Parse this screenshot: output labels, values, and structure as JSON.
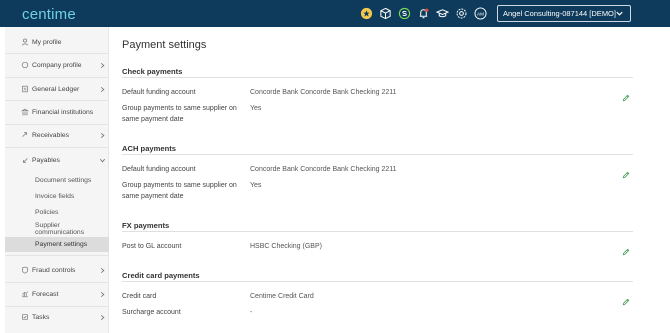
{
  "app": {
    "logo": "centime"
  },
  "header": {
    "icons": [
      "star-badge-icon",
      "cube-icon",
      "refresh-dollar-icon",
      "bell-icon",
      "graduation-cap-icon",
      "gear-icon",
      "user-initials-icon"
    ],
    "user_initials": "AM",
    "company": "Angel Consulting-087144 [DEMO]"
  },
  "sidebar": {
    "items": [
      {
        "label": "My profile",
        "icon": "user-icon"
      },
      {
        "label": "Company profile",
        "icon": "building-icon"
      },
      {
        "label": "General Ledger",
        "icon": "ledger-icon"
      },
      {
        "label": "Financial institutions",
        "icon": "bank-icon"
      },
      {
        "label": "Receivables",
        "icon": "receivables-icon"
      },
      {
        "label": "Payables",
        "icon": "payables-icon"
      },
      {
        "label": "Fraud controls",
        "icon": "shield-icon"
      },
      {
        "label": "Forecast",
        "icon": "chart-icon"
      },
      {
        "label": "Tasks",
        "icon": "tasks-icon"
      }
    ],
    "payables_sub": [
      {
        "label": "Document settings"
      },
      {
        "label": "Invoice fields"
      },
      {
        "label": "Policies"
      },
      {
        "label": "Supplier communications"
      },
      {
        "label": "Payment settings",
        "active": true
      }
    ]
  },
  "main": {
    "title": "Payment settings",
    "sections": [
      {
        "title": "Check payments",
        "fields": [
          {
            "label": "Default funding account",
            "value": "Concorde Bank Concorde Bank Checking 2211",
            "editable": true
          },
          {
            "label": "Group payments to same supplier on same payment date",
            "value": "Yes"
          }
        ]
      },
      {
        "title": "ACH payments",
        "fields": [
          {
            "label": "Default funding account",
            "value": "Concorde Bank Concorde Bank Checking 2211",
            "editable": true
          },
          {
            "label": "Group payments to same supplier on same payment date",
            "value": "Yes"
          }
        ]
      },
      {
        "title": "FX payments",
        "fields": [
          {
            "label": "Post to GL account",
            "value": "HSBC Checking (GBP)",
            "editable": true
          }
        ]
      },
      {
        "title": "Credit card payments",
        "fields": [
          {
            "label": "Credit card",
            "value": "Centime Credit Card",
            "editable": true
          },
          {
            "label": "Surcharge account",
            "value": "-"
          }
        ]
      }
    ]
  },
  "colors": {
    "topbar": "#0e3a5b",
    "logo": "#6fd0e8",
    "edit_icon": "#3a9a4a",
    "sidebar_bg": "#f5f5f5",
    "active_bg": "#dcdcdc"
  }
}
